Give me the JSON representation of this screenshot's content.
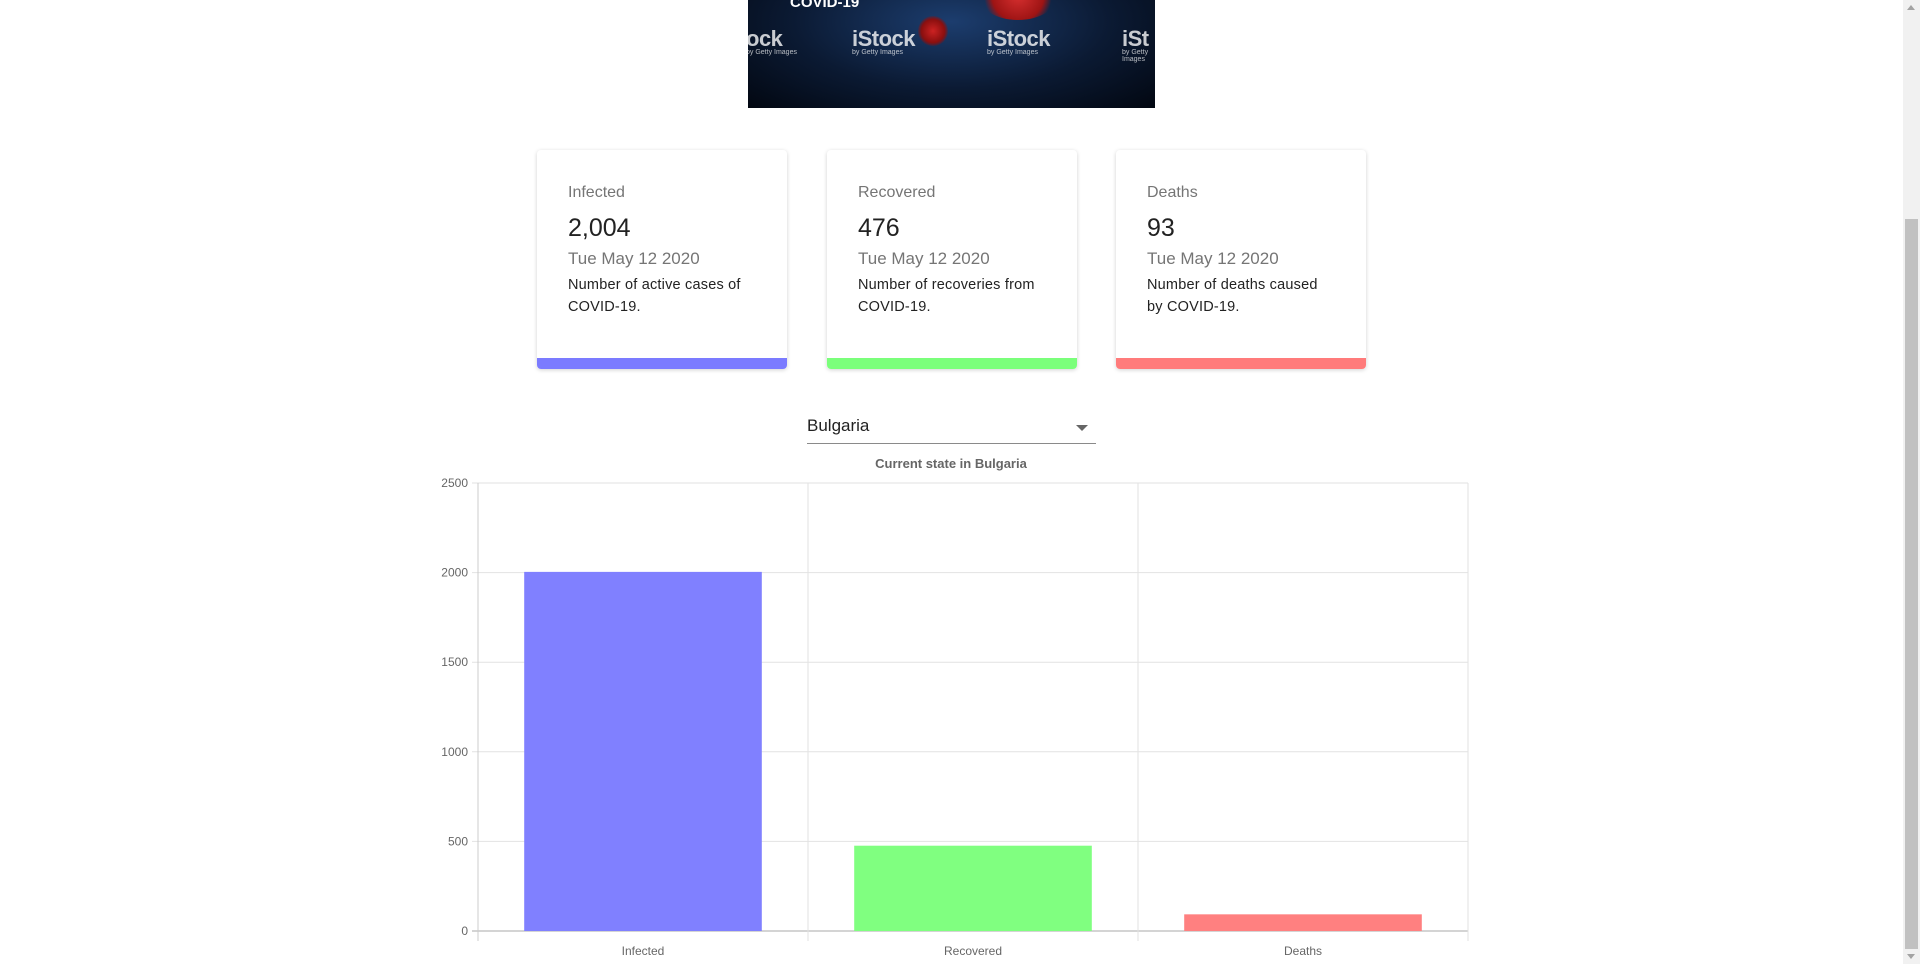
{
  "hero": {
    "caption": "COVID-19",
    "watermarks": [
      "ock",
      "iStock",
      "iStock",
      "iSt"
    ],
    "watermark_sub": "by Getty Images"
  },
  "cards": [
    {
      "title": "Infected",
      "value": "2,004",
      "date": "Tue May 12 2020",
      "description": "Number of active cases of COVID-19.",
      "color": "#7b7bff"
    },
    {
      "title": "Recovered",
      "value": "476",
      "date": "Tue May 12 2020",
      "description": "Number of recoveries from COVID-19.",
      "color": "#7bff7b"
    },
    {
      "title": "Deaths",
      "value": "93",
      "date": "Tue May 12 2020",
      "description": "Number of deaths caused by COVID-19.",
      "color": "#ff7b7b"
    }
  ],
  "country_select": {
    "value": "Bulgaria"
  },
  "chart_data": {
    "type": "bar",
    "title": "Current state in Bulgaria",
    "categories": [
      "Infected",
      "Recovered",
      "Deaths"
    ],
    "values": [
      2004,
      476,
      93
    ],
    "colors": [
      "#8080ff",
      "#80ff80",
      "#ff8080"
    ],
    "ylim": [
      0,
      2500
    ],
    "yticks": [
      0,
      500,
      1000,
      1500,
      2000,
      2500
    ],
    "grid": true,
    "legend": "none"
  }
}
